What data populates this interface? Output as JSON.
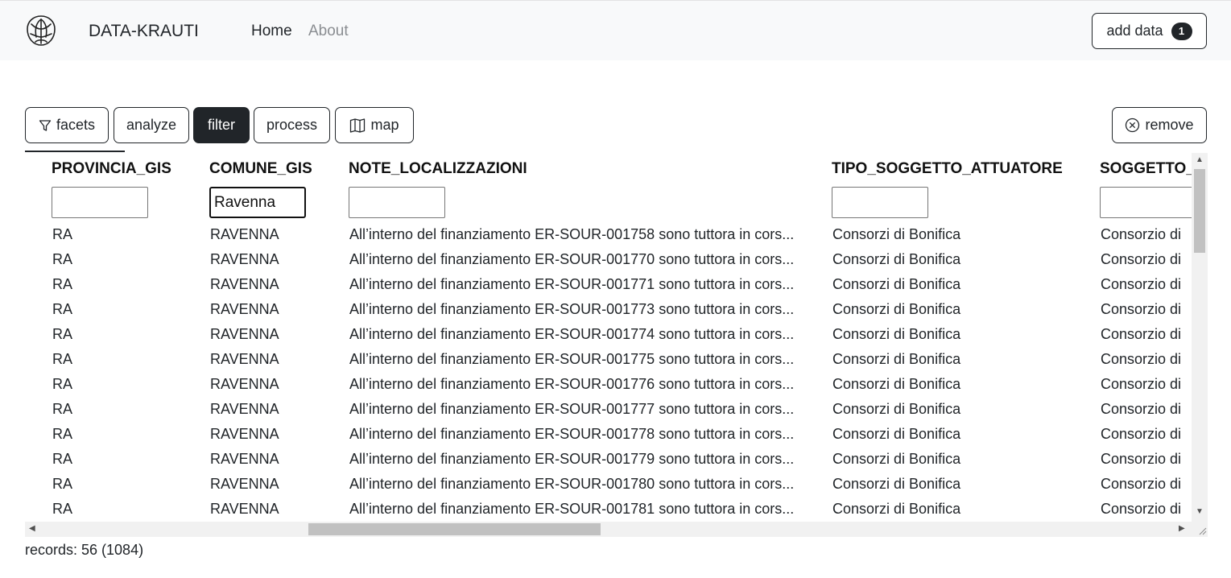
{
  "navbar": {
    "brand": "DATA-KRAUTI",
    "links": [
      {
        "label": "Home",
        "active": true
      },
      {
        "label": "About",
        "active": false
      }
    ],
    "add_data_label": "add data",
    "add_data_count": "1"
  },
  "toolbar": {
    "facets": "facets",
    "analyze": "analyze",
    "filter": "filter",
    "process": "process",
    "map": "map",
    "remove": "remove"
  },
  "table": {
    "columns": [
      {
        "label": "PROVINCIA_GIS",
        "filter": ""
      },
      {
        "label": "COMUNE_GIS",
        "filter": "Ravenna"
      },
      {
        "label": "NOTE_LOCALIZZAZIONI",
        "filter": ""
      },
      {
        "label": "TIPO_SOGGETTO_ATTUATORE",
        "filter": ""
      },
      {
        "label": "SOGGETTO_",
        "filter": ""
      }
    ],
    "rows": [
      [
        "RA",
        "RAVENNA",
        "All’interno del finanziamento ER-SOUR-001758 sono tuttora in cors...",
        "Consorzi di Bonifica",
        "Consorzio di"
      ],
      [
        "RA",
        "RAVENNA",
        "All’interno del finanziamento ER-SOUR-001770 sono tuttora in cors...",
        "Consorzi di Bonifica",
        "Consorzio di"
      ],
      [
        "RA",
        "RAVENNA",
        "All’interno del finanziamento ER-SOUR-001771 sono tuttora in cors...",
        "Consorzi di Bonifica",
        "Consorzio di"
      ],
      [
        "RA",
        "RAVENNA",
        "All’interno del finanziamento ER-SOUR-001773 sono tuttora in cors...",
        "Consorzi di Bonifica",
        "Consorzio di"
      ],
      [
        "RA",
        "RAVENNA",
        "All’interno del finanziamento ER-SOUR-001774 sono tuttora in cors...",
        "Consorzi di Bonifica",
        "Consorzio di"
      ],
      [
        "RA",
        "RAVENNA",
        "All’interno del finanziamento ER-SOUR-001775 sono tuttora in cors...",
        "Consorzi di Bonifica",
        "Consorzio di"
      ],
      [
        "RA",
        "RAVENNA",
        "All’interno del finanziamento ER-SOUR-001776 sono tuttora in cors...",
        "Consorzi di Bonifica",
        "Consorzio di"
      ],
      [
        "RA",
        "RAVENNA",
        "All’interno del finanziamento ER-SOUR-001777 sono tuttora in cors...",
        "Consorzi di Bonifica",
        "Consorzio di"
      ],
      [
        "RA",
        "RAVENNA",
        "All’interno del finanziamento ER-SOUR-001778 sono tuttora in cors...",
        "Consorzi di Bonifica",
        "Consorzio di"
      ],
      [
        "RA",
        "RAVENNA",
        "All’interno del finanziamento ER-SOUR-001779 sono tuttora in cors...",
        "Consorzi di Bonifica",
        "Consorzio di"
      ],
      [
        "RA",
        "RAVENNA",
        "All’interno del finanziamento ER-SOUR-001780 sono tuttora in cors...",
        "Consorzi di Bonifica",
        "Consorzio di"
      ],
      [
        "RA",
        "RAVENNA",
        "All’interno del finanziamento ER-SOUR-001781 sono tuttora in cors...",
        "Consorzi di Bonifica",
        "Consorzio di"
      ]
    ]
  },
  "footer": {
    "records": "records: 56 (1084)"
  },
  "icons": {
    "logo": "cabbage-logo",
    "facets": "filter-funnel-icon",
    "map": "map-icon",
    "remove": "circle-x-icon"
  },
  "colors": {
    "dark": "#212529",
    "navbar_bg": "#f8f9fa",
    "muted_link": "#8a8d91"
  }
}
